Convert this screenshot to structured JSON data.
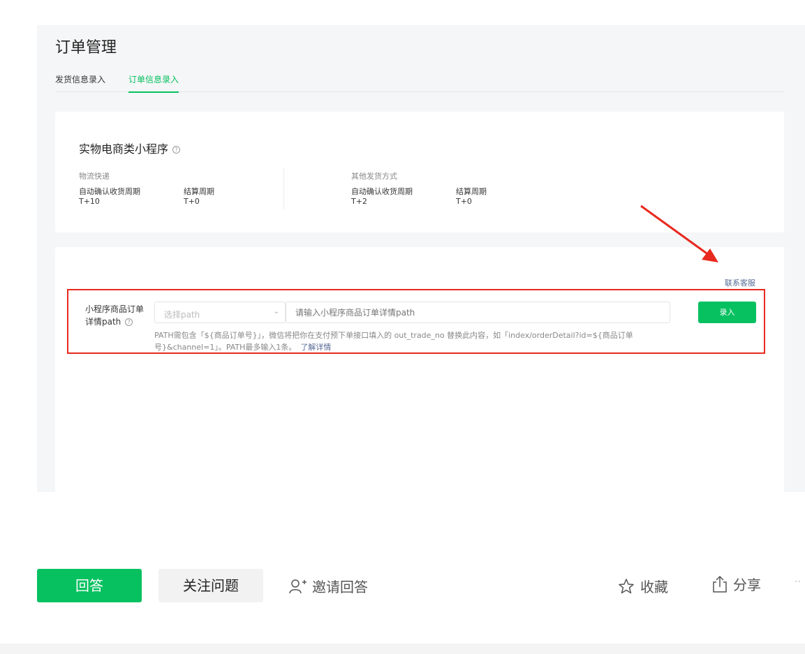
{
  "page": {
    "title": "订单管理"
  },
  "tabs": [
    {
      "label": "发货信息录入"
    },
    {
      "label": "订单信息录入"
    }
  ],
  "summary": {
    "title": "实物电商类小程序",
    "col1": {
      "heading": "物流快递",
      "label_a": "自动确认收货周期",
      "label_b": "结算周期",
      "value_a": "T+10",
      "value_b": "T+0"
    },
    "col2": {
      "heading": "其他发货方式",
      "label_a": "自动确认收货周期",
      "label_b": "结算周期",
      "value_a": "T+2",
      "value_b": "T+0"
    }
  },
  "form": {
    "contact": "联系客服",
    "label_line1": "小程序商品订单",
    "label_line2": "详情path",
    "select_placeholder": "选择path",
    "input_placeholder": "请输入小程序商品订单详情path",
    "submit": "录入",
    "hint": "PATH需包含「${商品订单号}」，微信将把你在支付预下单接口填入的 out_trade_no 替换此内容，如「index/orderDetail?id=${商品订单号}&channel=1」。PATH最多输入1条。",
    "hint_link": "了解详情"
  },
  "toolbar": {
    "answer": "回答",
    "follow": "关注问题",
    "invite": "邀请回答",
    "favorite": "收藏",
    "share": "分享",
    "more": "··"
  },
  "colors": {
    "accent": "#07c160",
    "link": "#576b95",
    "highlight": "#e8291e"
  },
  "icons": {
    "help": "question-circle-icon",
    "select": "chevron-down-icon",
    "invite": "user-plus-icon",
    "favorite": "star-icon",
    "share": "share-icon",
    "annotation": "red-arrow-icon"
  }
}
